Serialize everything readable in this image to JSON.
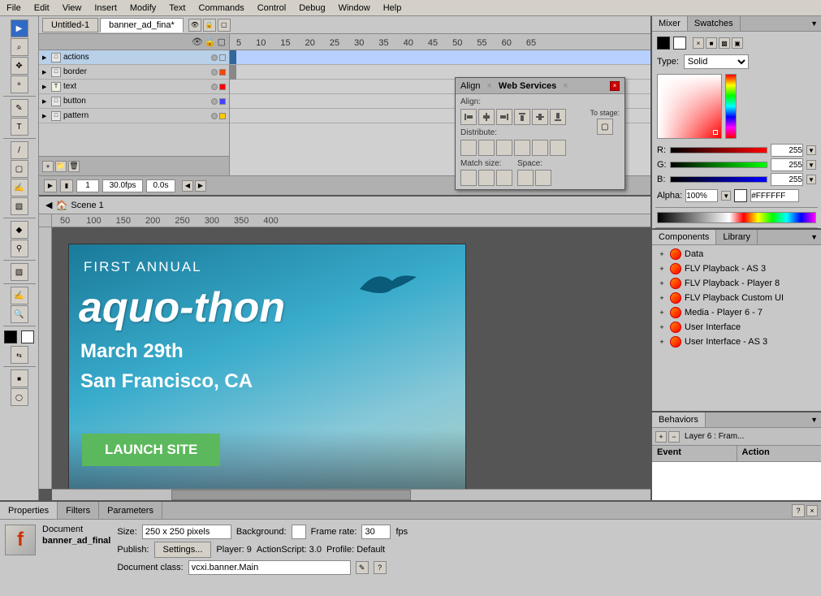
{
  "menubar": {
    "items": [
      "File",
      "Edit",
      "View",
      "Insert",
      "Modify",
      "Text",
      "Commands",
      "Control",
      "Debug",
      "Window",
      "Help"
    ]
  },
  "tabs": {
    "tab1": "Untitled-1",
    "tab2": "banner_ad_fina*"
  },
  "timeline": {
    "layers": [
      {
        "name": "actions",
        "color": "#ffffff",
        "dot_color": "#ffffff"
      },
      {
        "name": "border",
        "color": "#ff4400",
        "dot_color": "#ff4400"
      },
      {
        "name": "text",
        "color": "#ff0000",
        "dot_color": "#ff0000"
      },
      {
        "name": "button",
        "color": "#4444ff",
        "dot_color": "#4444ff"
      },
      {
        "name": "pattern",
        "color": "#ffcc00",
        "dot_color": "#ffcc00"
      }
    ],
    "fps": "30.0fps",
    "time": "0.0s",
    "frame": "1"
  },
  "breadcrumb": {
    "scene": "Scene 1"
  },
  "banner": {
    "line1": "FIRST ANNUAL",
    "line2": "aquo-thon",
    "line3": "March 29th",
    "line4": "San Francisco, CA",
    "button": "LAUNCH SITE"
  },
  "mixer_panel": {
    "tab1": "Mixer",
    "tab2": "Swatches",
    "type_label": "Type:",
    "type_value": "Solid",
    "r_label": "R:",
    "r_value": "255",
    "g_label": "G:",
    "g_value": "255",
    "b_label": "B:",
    "b_value": "255",
    "alpha_label": "Alpha:",
    "alpha_value": "100%",
    "hex_value": "#FFFFFF"
  },
  "components_panel": {
    "tab1": "Components",
    "tab2": "Library",
    "items": [
      {
        "name": "Data"
      },
      {
        "name": "FLV Playback - AS 3"
      },
      {
        "name": "FLV Playback - Player 8"
      },
      {
        "name": "FLV Playback Custom UI"
      },
      {
        "name": "Media - Player 6 - 7"
      },
      {
        "name": "User Interface"
      },
      {
        "name": "User Interface - AS 3"
      }
    ]
  },
  "behaviors_panel": {
    "tab": "Behaviors",
    "layer_label": "Layer 6 : Fram...",
    "col_event": "Event",
    "col_action": "Action"
  },
  "properties_panel": {
    "tab1": "Properties",
    "tab2": "Filters",
    "tab3": "Parameters",
    "doc_type": "Document",
    "doc_name": "banner_ad_final",
    "size_label": "Size:",
    "size_value": "250 x 250 pixels",
    "bg_label": "Background:",
    "fps_label": "Frame rate:",
    "fps_value": "30",
    "fps_unit": "fps",
    "publish_label": "Publish:",
    "settings_btn": "Settings...",
    "player_label": "Player: 9",
    "as_label": "ActionScript: 3.0",
    "profile_label": "Profile: Default",
    "class_label": "Document class:",
    "class_value": "vcxi.banner.Main"
  },
  "align_panel": {
    "tab1": "Align",
    "tab2": "Web Services",
    "align_label": "Align:",
    "distribute_label": "Distribute:",
    "matchsize_label": "Match size:",
    "space_label": "Space:",
    "tostage_label": "To stage:"
  }
}
